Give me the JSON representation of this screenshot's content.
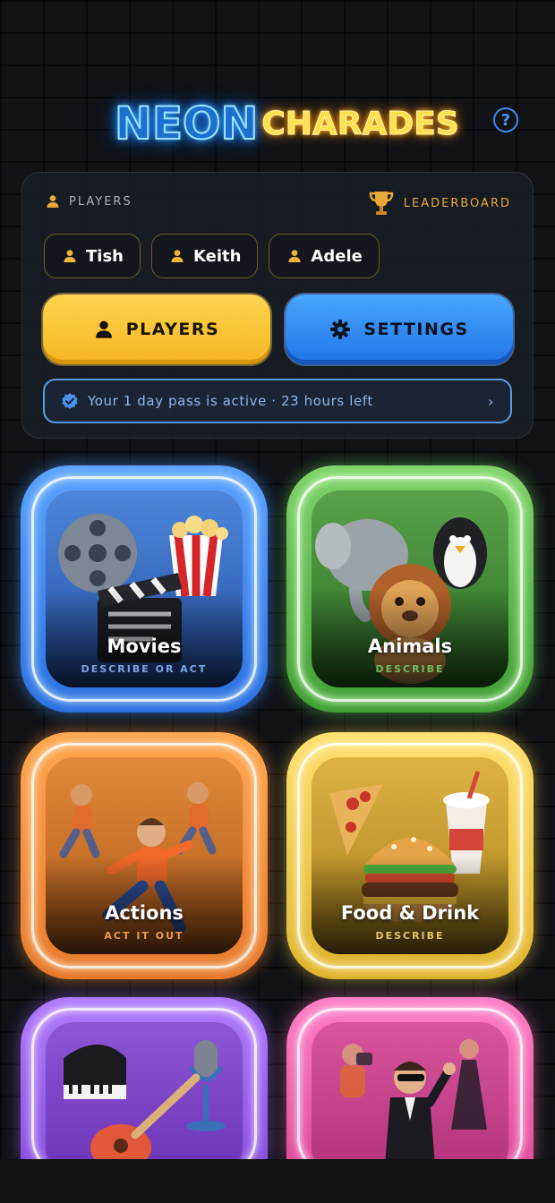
{
  "header": {
    "logo_part1": "NEON",
    "logo_part2": "CHARADES",
    "help_icon": "question-circle-icon"
  },
  "panel": {
    "players_label": "PLAYERS",
    "leaderboard_label": "LEADERBOARD",
    "players": [
      {
        "name": "Tish"
      },
      {
        "name": "Keith"
      },
      {
        "name": "Adele"
      }
    ],
    "players_button": "PLAYERS",
    "settings_button": "SETTINGS",
    "pass_text": "Your 1 day pass is active · 23 hours left",
    "pass_chevron": "›"
  },
  "categories": [
    {
      "title": "Movies",
      "subtitle": "DESCRIBE OR ACT",
      "color": "#3f86f0"
    },
    {
      "title": "Animals",
      "subtitle": "DESCRIBE",
      "color": "#5cbc4a"
    },
    {
      "title": "Actions",
      "subtitle": "ACT IT OUT",
      "color": "#f08a34"
    },
    {
      "title": "Food & Drink",
      "subtitle": "DESCRIBE",
      "color": "#f0c83c"
    },
    {
      "title": "",
      "subtitle": "",
      "color": "#9b5ff0"
    },
    {
      "title": "",
      "subtitle": "",
      "color": "#f062b4"
    }
  ],
  "colors": {
    "background": "#111317",
    "accent_blue": "#3d8bf0",
    "accent_yellow": "#f6b520",
    "leaderboard_gold": "#e7a93b"
  }
}
